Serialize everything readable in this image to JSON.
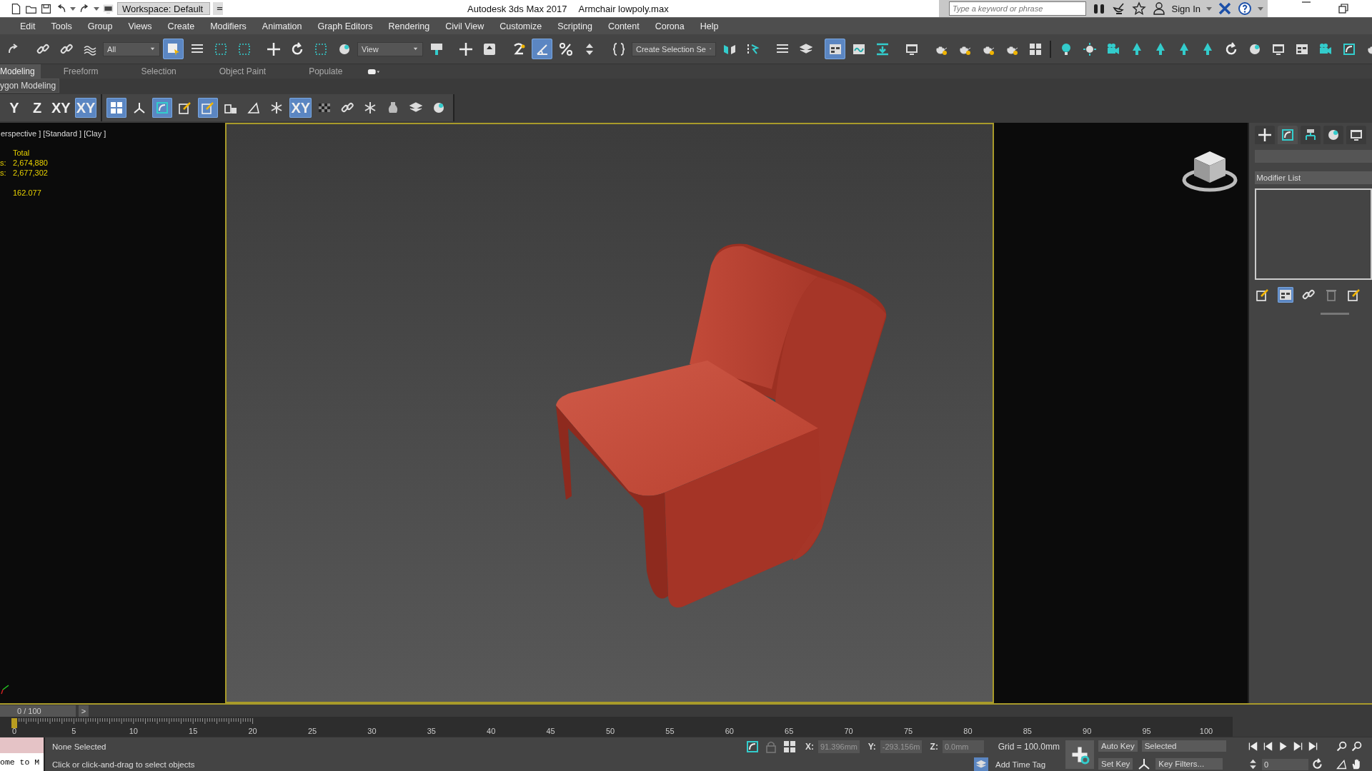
{
  "title_bar": {
    "workspace": "Workspace: Default",
    "app_title": "Autodesk 3ds Max 2017",
    "file_name": "Armchair lowpoly.max",
    "search": {
      "placeholder": "Type a keyword or phrase"
    },
    "sign_in": "Sign In"
  },
  "menu": [
    "Edit",
    "Tools",
    "Group",
    "Views",
    "Create",
    "Modifiers",
    "Animation",
    "Graph Editors",
    "Rendering",
    "Civil View",
    "Customize",
    "Scripting",
    "Content",
    "Corona",
    "Help"
  ],
  "main_toolbar": {
    "selection_filter": "All",
    "reference_coordinate": "View",
    "named_selection": "Create Selection Se",
    "buttons": [
      {
        "on": false
      },
      {
        "on": false
      },
      {
        "on": false
      },
      {
        "on": false
      },
      {
        "on": true
      },
      {
        "on": false
      },
      {
        "on": false
      },
      {
        "on": false
      },
      {
        "on": false
      },
      {
        "on": false
      },
      {
        "on": false
      },
      {
        "on": false
      },
      {
        "on": false
      },
      {
        "on": false
      },
      {
        "on": false
      },
      {
        "on": false
      },
      {
        "on": true
      },
      {
        "on": false
      },
      {
        "on": false
      },
      {
        "on": false
      },
      {
        "on": false
      },
      {
        "on": false
      },
      {
        "on": false
      },
      {
        "on": false
      },
      {
        "on": true
      },
      {
        "on": false
      },
      {
        "on": false
      },
      {
        "on": false
      },
      {
        "on": false
      },
      {
        "on": false
      },
      {
        "on": false
      },
      {
        "on": false
      },
      {
        "on": false
      },
      {
        "on": false
      },
      {
        "on": false
      },
      {
        "on": false
      },
      {
        "on": false
      },
      {
        "on": false
      },
      {
        "on": false
      },
      {
        "on": false
      },
      {
        "on": false
      },
      {
        "on": false
      },
      {
        "on": false
      },
      {
        "on": false
      },
      {
        "on": false
      },
      {
        "on": false
      },
      {
        "on": false
      }
    ]
  },
  "ribbon": {
    "tabs": [
      {
        "label": "Modeling",
        "selected": true
      },
      {
        "label": "Freeform",
        "selected": false
      },
      {
        "label": "Selection",
        "selected": false
      },
      {
        "label": "Object Paint",
        "selected": false
      },
      {
        "label": "Populate",
        "selected": false
      }
    ],
    "panel_title": "ygon Modeling",
    "tools": [
      {
        "label": "Y",
        "on": false
      },
      {
        "label": "Z",
        "on": false
      },
      {
        "label": "XY",
        "on": false
      },
      {
        "label": "XY",
        "on": true
      }
    ],
    "tools_2": [
      {
        "kind": "icon",
        "on": true
      },
      {
        "kind": "icon",
        "on": false
      },
      {
        "kind": "icon",
        "on": true
      },
      {
        "kind": "icon",
        "on": false
      },
      {
        "kind": "icon",
        "on": true
      },
      {
        "kind": "icon",
        "on": false
      },
      {
        "kind": "icon",
        "on": false
      },
      {
        "kind": "icon",
        "on": false
      },
      {
        "kind": "label",
        "label": "XY",
        "on": true
      },
      {
        "kind": "icon",
        "on": false
      },
      {
        "kind": "icon",
        "on": false
      },
      {
        "kind": "icon",
        "on": false
      },
      {
        "kind": "icon",
        "on": false
      },
      {
        "kind": "icon",
        "on": false
      },
      {
        "kind": "icon",
        "on": false
      }
    ]
  },
  "viewport": {
    "label": "erspective ] [Standard ] [Clay ]",
    "stats": {
      "header": "Total",
      "rows": [
        {
          "label": "s:",
          "value": "2,674,880"
        },
        {
          "label": "s:",
          "value": "2,677,302"
        }
      ],
      "fps": "162.077"
    }
  },
  "command_panel": {
    "tabs": [
      {
        "selected": false
      },
      {
        "selected": true
      },
      {
        "selected": false
      },
      {
        "selected": false
      },
      {
        "selected": false
      }
    ],
    "modifier_list": "Modifier List",
    "stack_tools": [
      {
        "on": false
      },
      {
        "on": true
      },
      {
        "on": false
      },
      {
        "on": false
      },
      {
        "on": false
      }
    ]
  },
  "time_slider": {
    "position": "0 / 100",
    "next": ">"
  },
  "trackbar": {
    "labels": [
      "0",
      "5",
      "10",
      "15",
      "20",
      "25",
      "30",
      "35",
      "40",
      "45",
      "50",
      "55",
      "60",
      "65",
      "70",
      "75",
      "80",
      "85",
      "90",
      "95",
      "100"
    ]
  },
  "status": {
    "listener": "ome to M",
    "selection": "None Selected",
    "prompt": "Click or click-and-drag to select objects",
    "x_label": "X:",
    "x": "91.396mm",
    "y_label": "Y:",
    "y": "-293.156m",
    "z_label": "Z:",
    "z": "0.0mm",
    "grid": "Grid = 100.0mm",
    "time_tag": "Add Time Tag",
    "auto_key": "Auto Key",
    "set_key": "Set Key",
    "key_mode": "Selected",
    "key_filters": "Key Filters...",
    "frame": "0"
  }
}
